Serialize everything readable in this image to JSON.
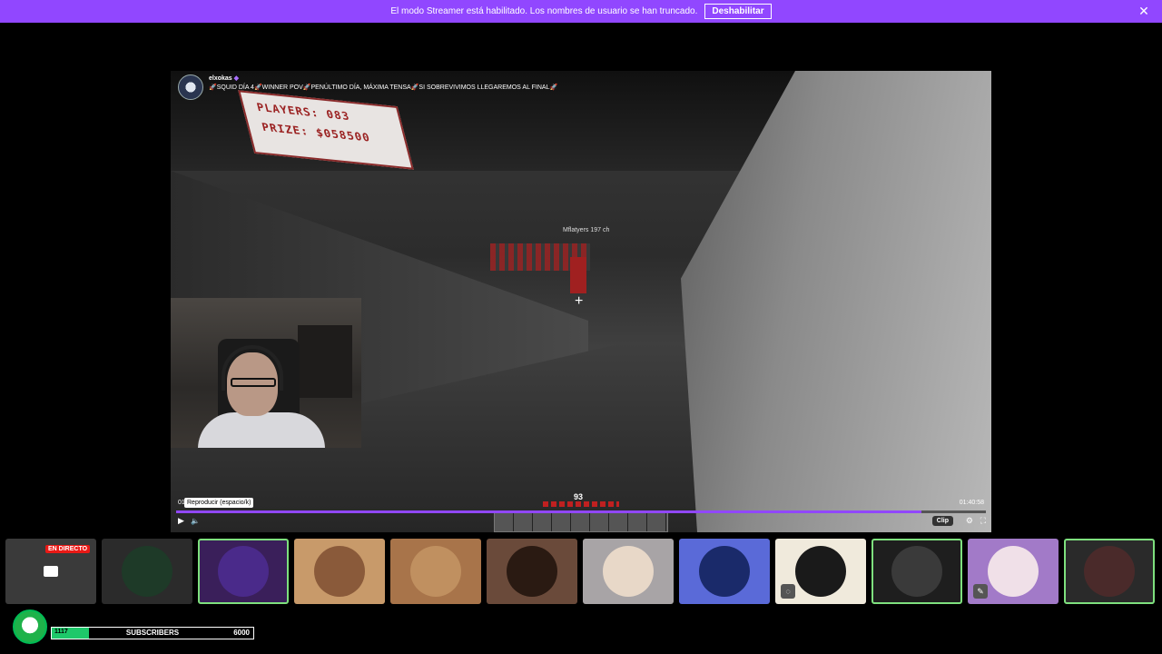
{
  "banner": {
    "message": "El modo Streamer está habilitado. Los nombres de usuario se han truncado.",
    "button_label": "Deshabilitar",
    "close_glyph": "✕",
    "color": "#9147ff"
  },
  "player": {
    "channel": "elxokas",
    "verified_glyph": "◆",
    "title": "🚀SQUID DÍA 4🚀WINNER POV🚀PENÚLTIMO DÍA, MÁXIMA TENSA🚀SI SOBREVIVIMOS LLEGAREMOS AL FINAL🚀",
    "game_sign_line1": "PLAYERS:    083",
    "game_sign_line2": "PRIZE:  $058500",
    "nametag": "Mflatyers 197 ch",
    "hud_number": "93",
    "time_current": "01",
    "time_total": "01:40:58",
    "tooltip": "Reproducir (espacio/k)",
    "progress_fraction": 0.92,
    "clip_label": "Clip",
    "play_icon": "play-icon",
    "volume_icon": "volume-icon",
    "settings_icon": "gear-icon",
    "fullscreen_icon": "fullscreen-icon",
    "accent": "#9147ff"
  },
  "tiles": [
    {
      "name": "live-channel",
      "live_label": "EN DIRECTO",
      "bg": "#3a3a3a"
    },
    {
      "name": "channel-green-bird",
      "bg": "#2b2b2b",
      "circle": "#1e3a28"
    },
    {
      "name": "channel-anime-blue",
      "bg": "#3a1f5a",
      "circle": "#4a2a8a",
      "selected": true
    },
    {
      "name": "channel-anime-girl",
      "bg": "#c89a6a",
      "circle": "#8a5a3a"
    },
    {
      "name": "channel-cat",
      "bg": "#a8744a",
      "circle": "#c09060"
    },
    {
      "name": "channel-mask",
      "bg": "#6a4a3a",
      "circle": "#2a1a12"
    },
    {
      "name": "channel-anime-white",
      "bg": "#a8a4a6",
      "circle": "#e8d8c8"
    },
    {
      "name": "channel-man-blue",
      "bg": "#5a6ad8",
      "circle": "#1a2a6a"
    },
    {
      "name": "channel-cartoon",
      "bg": "#f0eadc",
      "circle": "#1a1a1a",
      "badge": "◌"
    },
    {
      "name": "channel-silhouette",
      "bg": "#1e1e1e",
      "circle": "#3a3a3a",
      "selected": true
    },
    {
      "name": "channel-woman",
      "bg": "#a27ac8",
      "circle": "#f0e0e8",
      "badge": "✎"
    },
    {
      "name": "channel-blurred",
      "bg": "#2a2a2a",
      "circle": "#4a2a2a",
      "selected": true
    }
  ],
  "subscribers": {
    "current": "1117",
    "label": "SUBSCRIBERS",
    "goal": "6000",
    "progress_fraction": 0.186,
    "bar_color": "#1ec86a"
  }
}
